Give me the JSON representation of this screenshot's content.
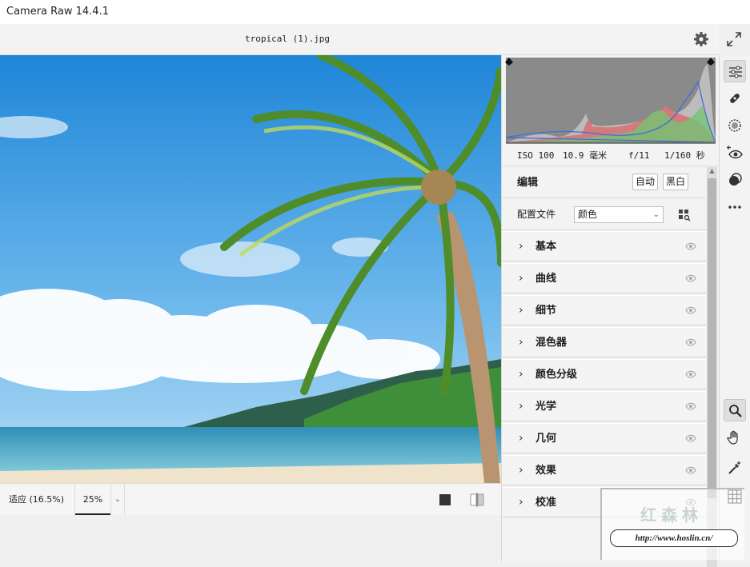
{
  "app": {
    "title": "Camera Raw 14.4.1"
  },
  "document": {
    "filename": "tropical (1).jpg"
  },
  "bottombar": {
    "zoom_fit": "适应 (16.5%)",
    "zoom_level": "25%"
  },
  "exif": {
    "iso": "ISO 100",
    "focal": "10.9 毫米",
    "aperture": "f/11",
    "shutter": "1/160 秒"
  },
  "edit": {
    "title": "编辑",
    "auto_label": "自动",
    "bw_label": "黑白"
  },
  "profile": {
    "label": "配置文件",
    "value": "颜色"
  },
  "sections": [
    {
      "label": "基本"
    },
    {
      "label": "曲线"
    },
    {
      "label": "细节"
    },
    {
      "label": "混色器"
    },
    {
      "label": "颜色分级"
    },
    {
      "label": "光学"
    },
    {
      "label": "几何"
    },
    {
      "label": "效果"
    },
    {
      "label": "校准"
    }
  ],
  "icons": {
    "settings": "gear-icon",
    "fullscreen": "expand-icon",
    "edit_tool": "sliders-icon",
    "heal": "bandage-icon",
    "mask": "mask-circle-icon",
    "redeye": "red-eye-icon",
    "presets": "presets-icon",
    "more": "more-icon",
    "zoom": "zoom-icon",
    "hand": "hand-icon",
    "sampler": "eyedropper-icon",
    "grid": "grid-icon"
  },
  "watermark": {
    "title": "红森林",
    "url": "http://www.hoslin.cn/"
  },
  "colors": {
    "accent": "#1473e6",
    "panel": "#f3f3f3",
    "sky": "#3d9be0"
  }
}
